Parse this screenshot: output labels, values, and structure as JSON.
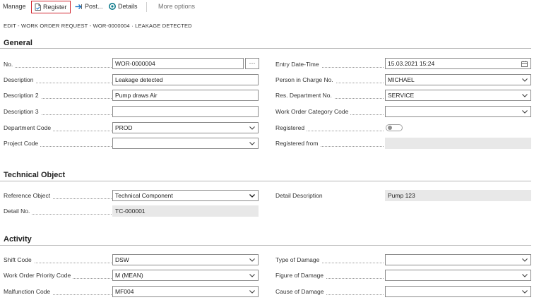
{
  "toolbar": {
    "manage": "Manage",
    "register": "Register",
    "post": "Post...",
    "details": "Details",
    "more_options": "More options"
  },
  "page_title": "EDIT - WORK ORDER REQUEST - WOR-0000004 · LEAKAGE DETECTED",
  "general": {
    "title": "General",
    "no_label": "No.",
    "no_value": "WOR-0000004",
    "description_label": "Description",
    "description_value": "Leakage detected",
    "description2_label": "Description 2",
    "description2_value": "Pump draws Air",
    "description3_label": "Description 3",
    "description3_value": "",
    "department_code_label": "Department Code",
    "department_code_value": "PROD",
    "project_code_label": "Project Code",
    "project_code_value": "",
    "entry_datetime_label": "Entry Date-Time",
    "entry_datetime_value": "15.03.2021 15:24",
    "person_in_charge_label": "Person in Charge No.",
    "person_in_charge_value": "MICHAEL",
    "res_department_label": "Res. Department No.",
    "res_department_value": "SERVICE",
    "wo_category_label": "Work Order Category Code",
    "wo_category_value": "",
    "registered_label": "Registered",
    "registered_from_label": "Registered from",
    "registered_from_value": ""
  },
  "technical_object": {
    "title": "Technical Object",
    "reference_object_label": "Reference Object",
    "reference_object_value": "Technical Component",
    "detail_no_label": "Detail No.",
    "detail_no_value": "TC-000001",
    "detail_description_label": "Detail Description",
    "detail_description_value": "Pump 123"
  },
  "activity": {
    "title": "Activity",
    "shift_code_label": "Shift Code",
    "shift_code_value": "DSW",
    "wo_priority_label": "Work Order Priority Code",
    "wo_priority_value": "M (MEAN)",
    "malfunction_code_label": "Malfunction Code",
    "malfunction_code_value": "MF004",
    "type_of_damage_label": "Type of Damage",
    "type_of_damage_value": "",
    "figure_of_damage_label": "Figure of Damage",
    "figure_of_damage_value": "",
    "cause_of_damage_label": "Cause of Damage",
    "cause_of_damage_value": ""
  },
  "colors": {
    "accent_blue": "#0f6fc6",
    "register_border": "#d1252f",
    "readonly_bg": "#e8e8e8"
  },
  "icons": {
    "register": "document-icon",
    "post": "post-arrow-icon",
    "details": "details-circle-icon",
    "lookup": "ellipsis-icon",
    "dropdown": "chevron-down-icon",
    "date": "calendar-icon"
  }
}
